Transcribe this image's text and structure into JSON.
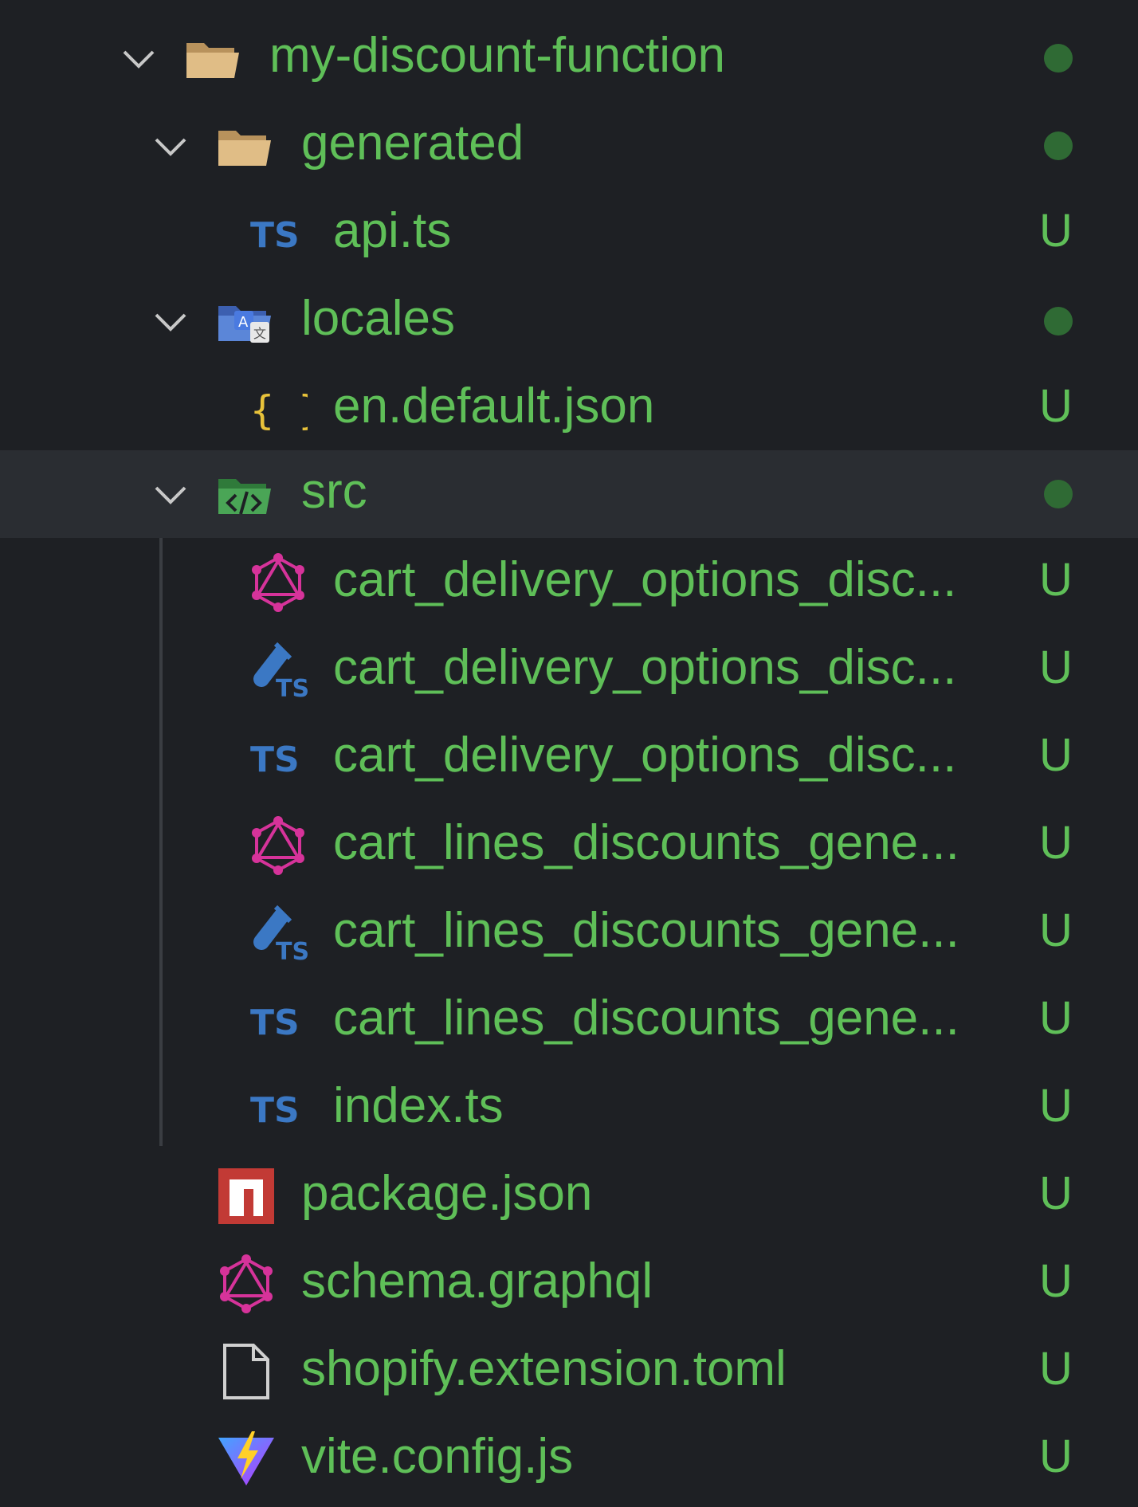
{
  "colors": {
    "background": "#1e2024",
    "selected_row": "#2a2d32",
    "label_green": "#5fbf58",
    "status_dot": "#2f6a34",
    "folder": "#d8b37a",
    "ts_blue": "#3b78c4",
    "graphql_pink": "#d6339a",
    "json_yellow": "#e8c23a",
    "npm_red": "#c23a35"
  },
  "tree": {
    "root": {
      "label": "my-discount-function",
      "icon": "folder-open-icon",
      "expanded": true,
      "status": "dot"
    },
    "items": [
      {
        "label": "generated",
        "icon": "folder-open-icon",
        "expanded": true,
        "status": "dot"
      },
      {
        "label": "api.ts",
        "icon": "typescript-icon",
        "status": "U"
      },
      {
        "label": "locales",
        "icon": "locale-folder-icon",
        "expanded": true,
        "status": "dot"
      },
      {
        "label": "en.default.json",
        "icon": "json-braces-icon",
        "status": "U"
      },
      {
        "label": "src",
        "icon": "source-folder-icon",
        "expanded": true,
        "status": "dot",
        "selected": true
      },
      {
        "label": "cart_delivery_options_disc...",
        "icon": "graphql-icon",
        "status": "U"
      },
      {
        "label": "cart_delivery_options_disc...",
        "icon": "typescript-test-icon",
        "status": "U"
      },
      {
        "label": "cart_delivery_options_disc...",
        "icon": "typescript-icon",
        "status": "U"
      },
      {
        "label": "cart_lines_discounts_gene...",
        "icon": "graphql-icon",
        "status": "U"
      },
      {
        "label": "cart_lines_discounts_gene...",
        "icon": "typescript-test-icon",
        "status": "U"
      },
      {
        "label": "cart_lines_discounts_gene...",
        "icon": "typescript-icon",
        "status": "U"
      },
      {
        "label": "index.ts",
        "icon": "typescript-icon",
        "status": "U"
      },
      {
        "label": "package.json",
        "icon": "npm-icon",
        "status": "U"
      },
      {
        "label": "schema.graphql",
        "icon": "graphql-icon",
        "status": "U"
      },
      {
        "label": "shopify.extension.toml",
        "icon": "file-icon",
        "status": "U"
      },
      {
        "label": "vite.config.js",
        "icon": "vite-icon",
        "status": "U"
      }
    ]
  }
}
